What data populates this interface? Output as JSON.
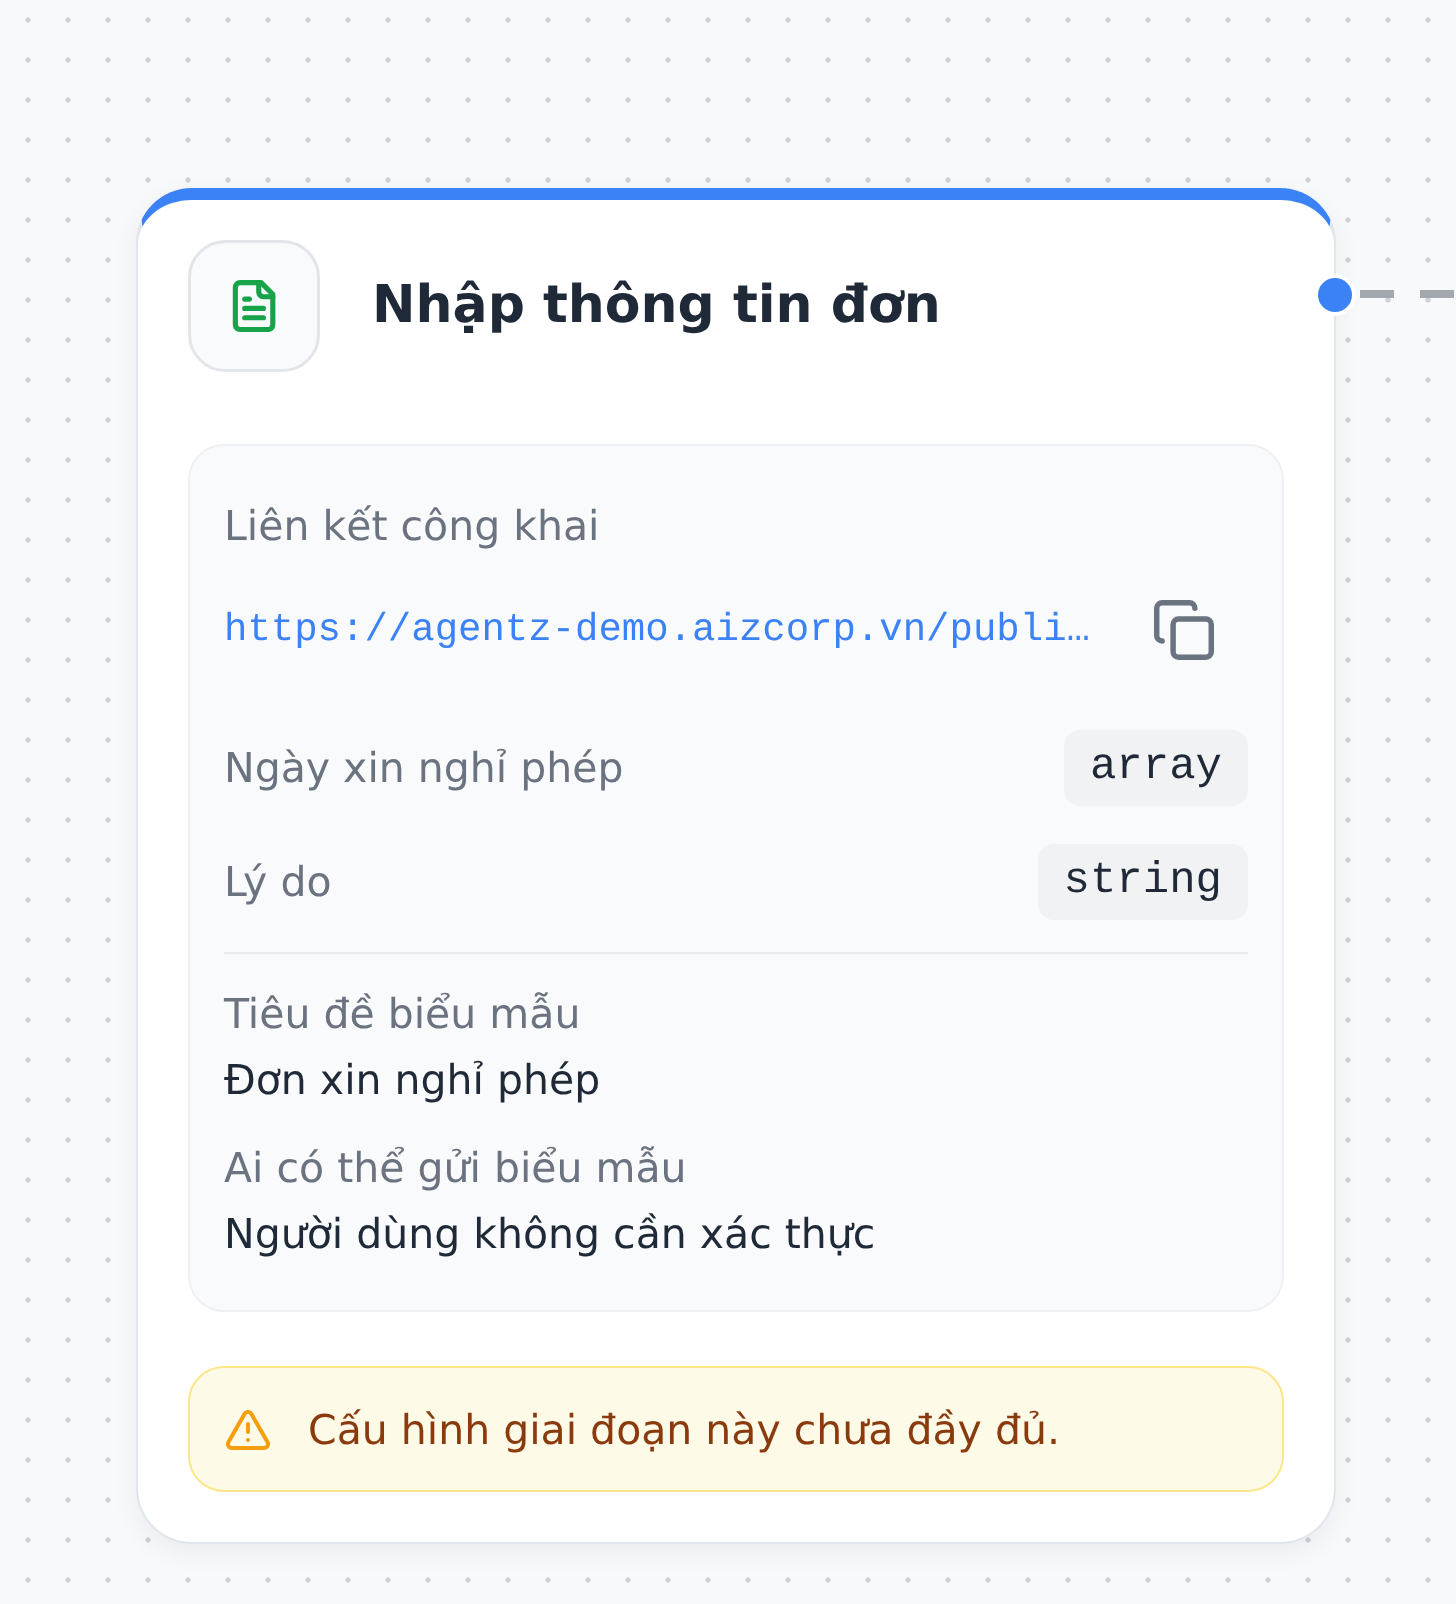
{
  "node": {
    "title": "Nhập thông tin đơn",
    "public_link": {
      "label": "Liên kết công khai",
      "url": "https://agentz-demo.aizcorp.vn/publi…"
    },
    "fields": [
      {
        "name": "Ngày xin nghỉ phép",
        "type": "array"
      },
      {
        "name": "Lý do",
        "type": "string"
      }
    ],
    "details": [
      {
        "label": "Tiêu đề biểu mẫu",
        "value": "Đơn xin nghỉ phép"
      },
      {
        "label": "Ai có thể gửi biểu mẫu",
        "value": "Người dùng không cần xác thực"
      }
    ],
    "warning": {
      "text": "Cấu hình giai đoạn này chưa đầy đủ."
    }
  }
}
